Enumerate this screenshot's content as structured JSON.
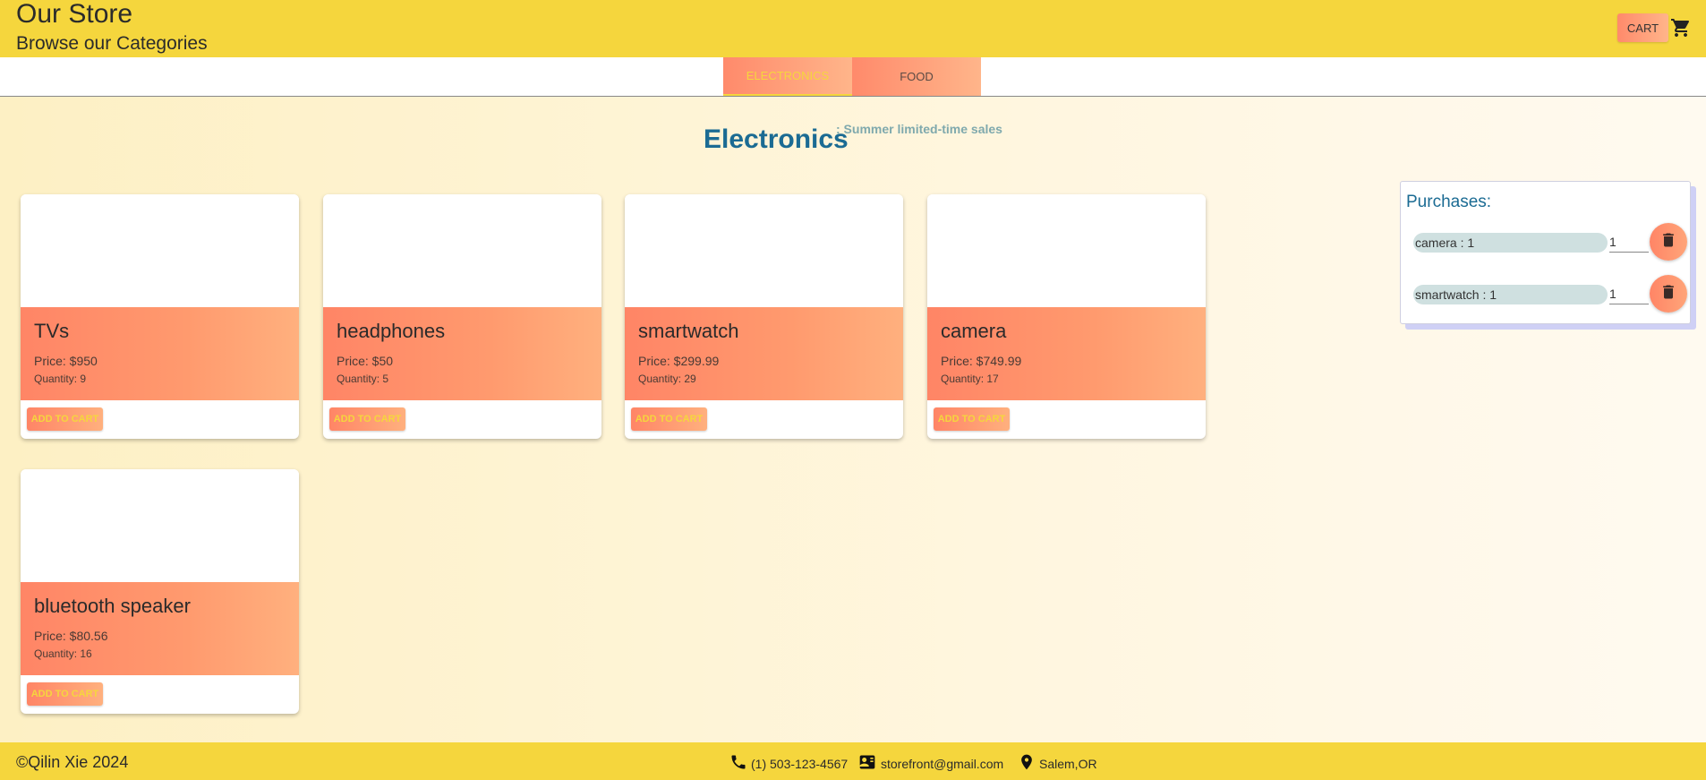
{
  "header": {
    "title": "Our Store",
    "subtitle": "Browse our Categories",
    "cart_label": "CART",
    "cart_icon": "shopping-cart-icon"
  },
  "tabs": [
    {
      "label": "ELECTRONICS",
      "active": true
    },
    {
      "label": "FOOD",
      "active": false
    }
  ],
  "section": {
    "title": "Electronics",
    "subtitle": ": Summer limited-time sales"
  },
  "products": [
    {
      "name": "TVs",
      "price": "Price: $950",
      "quantity": "Quantity: 9",
      "button": "ADD TO CART"
    },
    {
      "name": "headphones",
      "price": "Price: $50",
      "quantity": "Quantity: 5",
      "button": "ADD TO CART"
    },
    {
      "name": "smartwatch",
      "price": "Price: $299.99",
      "quantity": "Quantity: 29",
      "button": "ADD TO CART"
    },
    {
      "name": "camera",
      "price": "Price: $749.99",
      "quantity": "Quantity: 17",
      "button": "ADD TO CART"
    },
    {
      "name": "bluetooth speaker",
      "price": "Price: $80.56",
      "quantity": "Quantity: 16",
      "button": "ADD TO CART"
    }
  ],
  "purchases": {
    "title": "Purchases:",
    "items": [
      {
        "label": "camera : 1",
        "qty": "1"
      },
      {
        "label": "smartwatch : 1",
        "qty": "1"
      }
    ]
  },
  "footer": {
    "copyright": "©Qilin Xie 2024",
    "phone": "(1) 503-123-4567",
    "email": "storefront@gmail.com",
    "location": "Salem,OR"
  },
  "colors": {
    "header_bg": "#f5d63d",
    "accent_gradient_start": "#ff8566",
    "accent_gradient_end": "#ffb07e",
    "title_blue": "#1b6b93"
  }
}
